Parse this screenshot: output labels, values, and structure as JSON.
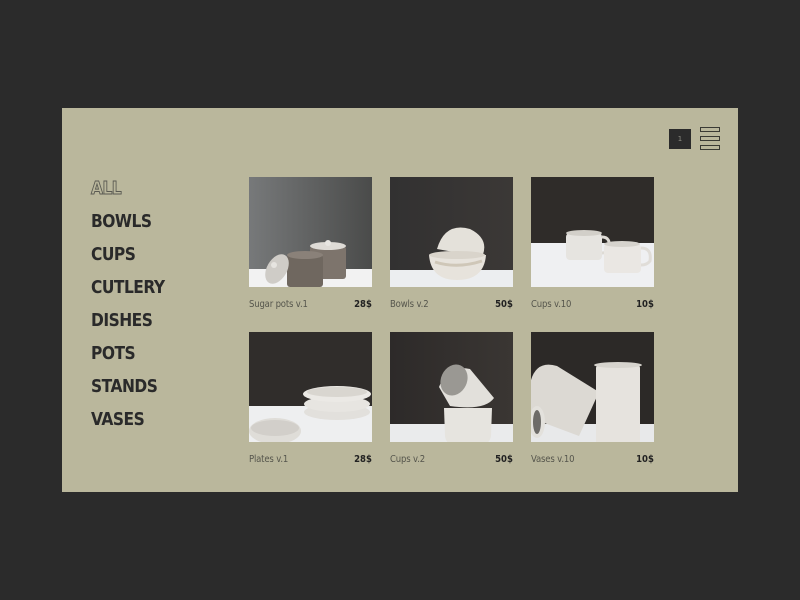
{
  "pagination": {
    "current_page": "1"
  },
  "categories": [
    {
      "label": "ALL",
      "active": true
    },
    {
      "label": "BOWLS",
      "active": false
    },
    {
      "label": "CUPS",
      "active": false
    },
    {
      "label": "CUTLERY",
      "active": false
    },
    {
      "label": "DISHES",
      "active": false
    },
    {
      "label": "POTS",
      "active": false
    },
    {
      "label": "STANDS",
      "active": false
    },
    {
      "label": "VASES",
      "active": false
    }
  ],
  "products": [
    {
      "name": "Sugar pots v.1",
      "price": "28$",
      "image": "sugar-pots-photo"
    },
    {
      "name": "Bowls v.2",
      "price": "50$",
      "image": "bowls-photo"
    },
    {
      "name": "Cups v.10",
      "price": "10$",
      "image": "cups-photo"
    },
    {
      "name": "Plates v.1",
      "price": "28$",
      "image": "plates-photo"
    },
    {
      "name": "Cups v.2",
      "price": "50$",
      "image": "stacked-cups-photo"
    },
    {
      "name": "Vases v.10",
      "price": "10$",
      "image": "vases-photo"
    }
  ],
  "icons": {
    "menu": "hamburger-menu-icon"
  },
  "colors": {
    "background": "#2b2b2b",
    "panel": "#bab79c",
    "text_dark": "#2a2a2a",
    "text_muted": "#55554c"
  }
}
